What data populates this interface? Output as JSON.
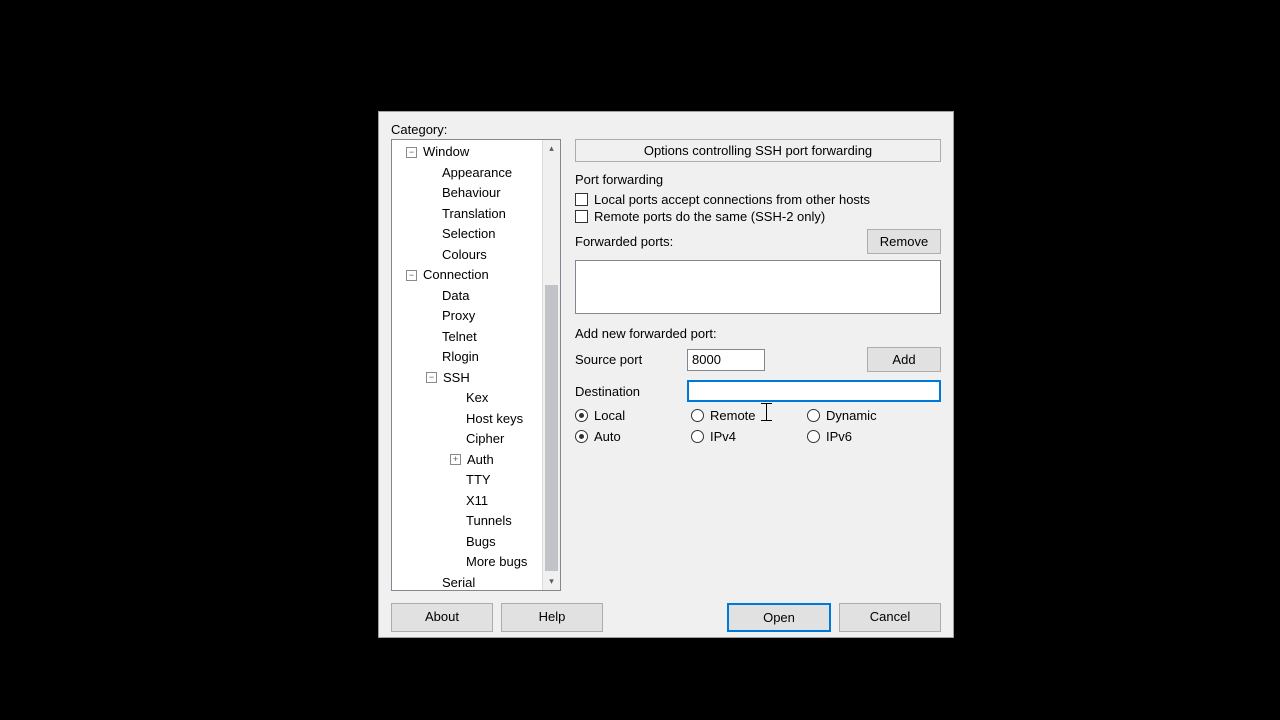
{
  "labels": {
    "category": "Category:",
    "panel_title": "Options controlling SSH port forwarding",
    "group": "Port forwarding",
    "chk_local": "Local ports accept connections from other hosts",
    "chk_remote": "Remote ports do the same (SSH-2 only)",
    "forwarded_ports": "Forwarded ports:",
    "remove": "Remove",
    "add_new": "Add new forwarded port:",
    "source_port": "Source port",
    "add": "Add",
    "destination": "Destination",
    "about": "About",
    "help": "Help",
    "open": "Open",
    "cancel": "Cancel"
  },
  "values": {
    "source_port": "8000",
    "destination": ""
  },
  "checks": {
    "local_accept": false,
    "remote_same": false
  },
  "radios": {
    "type": [
      {
        "label": "Local",
        "checked": true
      },
      {
        "label": "Remote",
        "checked": false
      },
      {
        "label": "Dynamic",
        "checked": false
      }
    ],
    "family": [
      {
        "label": "Auto",
        "checked": true
      },
      {
        "label": "IPv4",
        "checked": false
      },
      {
        "label": "IPv6",
        "checked": false
      }
    ]
  },
  "tree": [
    {
      "indent": 12,
      "expand": "-",
      "label": "Window"
    },
    {
      "indent": 46,
      "label": "Appearance"
    },
    {
      "indent": 46,
      "label": "Behaviour"
    },
    {
      "indent": 46,
      "label": "Translation"
    },
    {
      "indent": 46,
      "label": "Selection"
    },
    {
      "indent": 46,
      "label": "Colours"
    },
    {
      "indent": 12,
      "expand": "-",
      "label": "Connection"
    },
    {
      "indent": 46,
      "label": "Data"
    },
    {
      "indent": 46,
      "label": "Proxy"
    },
    {
      "indent": 46,
      "label": "Telnet"
    },
    {
      "indent": 46,
      "label": "Rlogin"
    },
    {
      "indent": 32,
      "expand": "-",
      "label": "SSH"
    },
    {
      "indent": 70,
      "label": "Kex"
    },
    {
      "indent": 70,
      "label": "Host keys"
    },
    {
      "indent": 70,
      "label": "Cipher"
    },
    {
      "indent": 56,
      "expand": "+",
      "label": "Auth"
    },
    {
      "indent": 70,
      "label": "TTY"
    },
    {
      "indent": 70,
      "label": "X11"
    },
    {
      "indent": 70,
      "label": "Tunnels"
    },
    {
      "indent": 70,
      "label": "Bugs"
    },
    {
      "indent": 70,
      "label": "More bugs"
    },
    {
      "indent": 46,
      "label": "Serial"
    }
  ]
}
